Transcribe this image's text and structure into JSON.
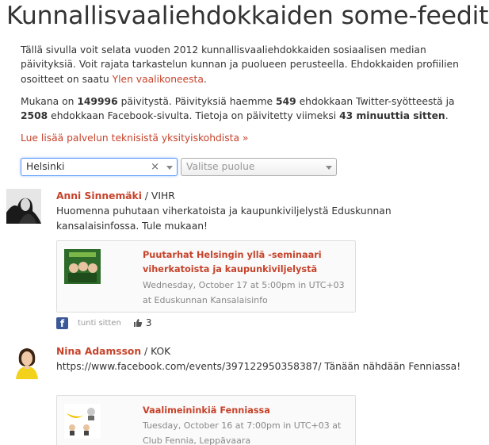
{
  "page": {
    "title": "Kunnallisvaaliehdokkaiden some-feedit"
  },
  "intro": {
    "p1_text": "Tällä sivulla voit selata vuoden 2012 kunnallisvaaliehdokkaiden sosiaalisen median päivityksiä. Voit rajata tarkastelun kunnan ja puolueen perusteella. Ehdokkaiden profiilien osoitteet on saatu ",
    "p1_link": "Ylen vaalikoneesta",
    "p1_end": ".",
    "p2_a": "Mukana on ",
    "p2_count": "149996",
    "p2_b": " päivitystä. Päivityksiä haemme ",
    "p2_twitter": "549",
    "p2_c": " ehdokkaan Twitter-syötteestä ja ",
    "p2_facebook": "2508",
    "p2_d": " ehdokkaan Facebook-sivulta. Tietoja on päivitetty viimeksi ",
    "p2_updated": "43 minuuttia sitten",
    "p2_e": ".",
    "more_link": "Lue lisää palvelun teknisistä yksityiskohdista »"
  },
  "filters": {
    "municipality_value": "Helsinki",
    "clear_symbol": "×",
    "party_placeholder": "Valitse puolue"
  },
  "posts": [
    {
      "author": "Anni Sinnemäki",
      "party": " / VIHR",
      "text": "Huomenna puhutaan viherkatoista ja kaupunkiviljelystä Eduskunnan kansalaisinfossa. Tule mukaan!",
      "event_title": "Puutarhat Helsingin yllä -seminaari viherkatoista ja kaupunkiviljelystä",
      "event_time": "Wednesday, October 17 at 5:00pm in UTC+03 at Eduskunnan Kansalaisinfo",
      "timeago": "tunti sitten",
      "likes": "3"
    },
    {
      "author": "Nina Adamsson",
      "party": " / KOK",
      "text": "https://www.facebook.com/events/397122950358387/ Tänään nähdään Fenniassa!",
      "event_title": "Vaalimeininkiä Fenniassa",
      "event_time": "Tuesday, October 16 at 7:00pm in UTC+03 at Club Fennia, Leppävaara"
    }
  ],
  "colors": {
    "accent": "#c6432b",
    "facebook": "#3b5998",
    "focus": "#5897fb"
  }
}
